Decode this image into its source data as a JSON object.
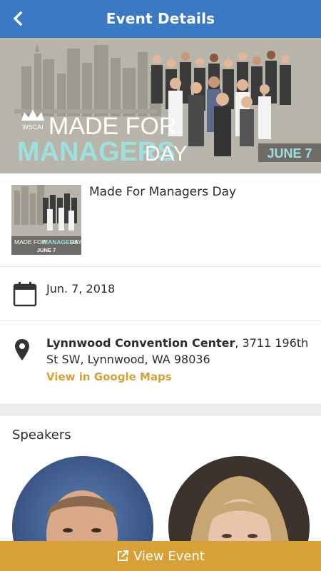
{
  "header": {
    "title": "Event Details",
    "back_icon": "chevron-left-icon"
  },
  "banner": {
    "brand": "WSCAI",
    "line1": "MADE FOR",
    "line2_bold": "MANAGERS",
    "line2_rest": "DAY",
    "date_tag": "JUNE 7"
  },
  "event": {
    "name": "Made For Managers Day",
    "thumb_line1": "MADE FOR",
    "thumb_bold": "MANAGERS",
    "thumb_rest": "DAY",
    "thumb_date": "JUNE 7",
    "date": "Jun. 7, 2018",
    "location_name": "Lynnwood Convention Center",
    "location_address": ", 3711 196th St SW, Lynnwood, WA 98036",
    "maps_link": "View in Google Maps"
  },
  "speakers": {
    "heading": "Speakers"
  },
  "footer": {
    "button_label": "View Event",
    "button_icon": "external-link-icon"
  },
  "colors": {
    "header": "#3a79c4",
    "accent": "#d8a135",
    "banner_bg": "#b7b4a9",
    "banner_teal": "#9fe0de"
  }
}
